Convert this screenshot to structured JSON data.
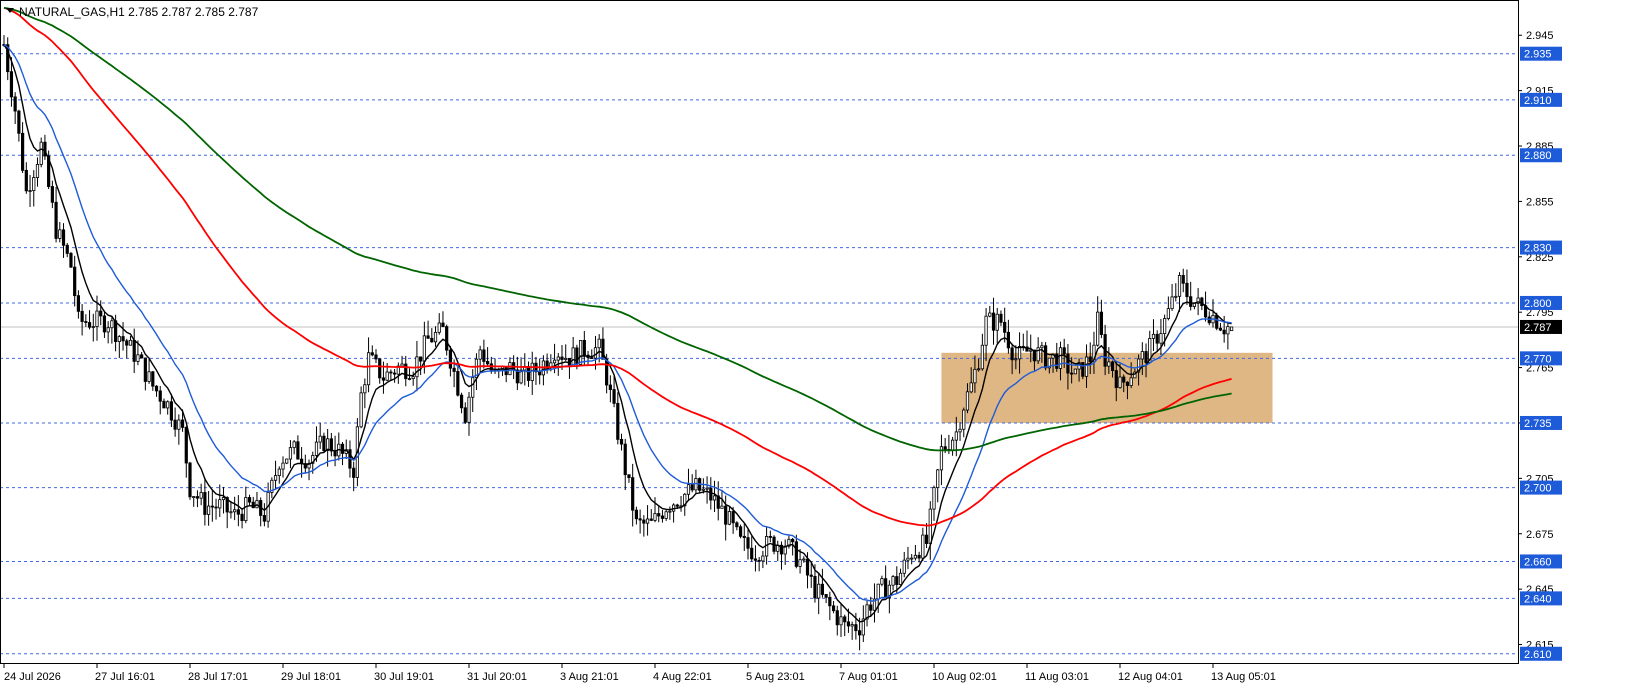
{
  "header": {
    "symbol_line": "NATURAL_GAS,H1  2.785 2.787 2.785 2.787",
    "menu_icon": "triangle-down-icon"
  },
  "chart_data": {
    "type": "candlestick",
    "symbol": "NATURAL_GAS",
    "timeframe": "H1",
    "ohlc_last": {
      "open": 2.785,
      "high": 2.787,
      "low": 2.785,
      "close": 2.787
    },
    "current_price": 2.787,
    "ylim": [
      2.605,
      2.963
    ],
    "y_ticks": [
      2.945,
      2.915,
      2.885,
      2.855,
      2.825,
      2.795,
      2.765,
      2.735,
      2.705,
      2.675,
      2.645,
      2.615
    ],
    "price_levels": [
      2.935,
      2.91,
      2.88,
      2.83,
      2.8,
      2.77,
      2.735,
      2.7,
      2.66,
      2.64,
      2.61
    ],
    "x_labels": [
      "24 Jul 2026",
      "27 Jul 16:01",
      "28 Jul 17:01",
      "29 Jul 18:01",
      "30 Jul 19:01",
      "31 Jul 20:01",
      "3 Aug 21:01",
      "4 Aug 22:01",
      "5 Aug 23:01",
      "7 Aug 01:01",
      "10 Aug 02:01",
      "11 Aug 03:01",
      "12 Aug 04:01",
      "13 Aug 05:01"
    ],
    "x_label_bars": [
      0,
      25,
      50,
      75,
      100,
      125,
      150,
      175,
      200,
      225,
      250,
      275,
      300,
      325
    ],
    "bar_count": 331,
    "close_anchors": [
      [
        0,
        2.94
      ],
      [
        3,
        2.905
      ],
      [
        6,
        2.86
      ],
      [
        10,
        2.885
      ],
      [
        14,
        2.84
      ],
      [
        18,
        2.82
      ],
      [
        20,
        2.79
      ],
      [
        24,
        2.79
      ],
      [
        28,
        2.79
      ],
      [
        32,
        2.78
      ],
      [
        36,
        2.77
      ],
      [
        40,
        2.755
      ],
      [
        44,
        2.745
      ],
      [
        48,
        2.73
      ],
      [
        50,
        2.7
      ],
      [
        54,
        2.69
      ],
      [
        58,
        2.69
      ],
      [
        62,
        2.685
      ],
      [
        66,
        2.69
      ],
      [
        70,
        2.685
      ],
      [
        72,
        2.7
      ],
      [
        74,
        2.715
      ],
      [
        78,
        2.72
      ],
      [
        82,
        2.715
      ],
      [
        86,
        2.725
      ],
      [
        90,
        2.72
      ],
      [
        94,
        2.71
      ],
      [
        96,
        2.75
      ],
      [
        98,
        2.77
      ],
      [
        102,
        2.76
      ],
      [
        106,
        2.765
      ],
      [
        110,
        2.765
      ],
      [
        114,
        2.78
      ],
      [
        118,
        2.785
      ],
      [
        120,
        2.77
      ],
      [
        122,
        2.755
      ],
      [
        124,
        2.74
      ],
      [
        126,
        2.76
      ],
      [
        128,
        2.775
      ],
      [
        132,
        2.76
      ],
      [
        136,
        2.765
      ],
      [
        140,
        2.76
      ],
      [
        144,
        2.765
      ],
      [
        148,
        2.775
      ],
      [
        152,
        2.77
      ],
      [
        156,
        2.775
      ],
      [
        160,
        2.775
      ],
      [
        162,
        2.76
      ],
      [
        166,
        2.72
      ],
      [
        170,
        2.68
      ],
      [
        174,
        2.68
      ],
      [
        178,
        2.69
      ],
      [
        182,
        2.695
      ],
      [
        186,
        2.7
      ],
      [
        190,
        2.695
      ],
      [
        194,
        2.685
      ],
      [
        198,
        2.67
      ],
      [
        202,
        2.665
      ],
      [
        206,
        2.67
      ],
      [
        210,
        2.67
      ],
      [
        214,
        2.66
      ],
      [
        218,
        2.645
      ],
      [
        222,
        2.635
      ],
      [
        226,
        2.625
      ],
      [
        230,
        2.625
      ],
      [
        232,
        2.635
      ],
      [
        236,
        2.645
      ],
      [
        240,
        2.65
      ],
      [
        244,
        2.665
      ],
      [
        248,
        2.67
      ],
      [
        250,
        2.695
      ],
      [
        252,
        2.72
      ],
      [
        256,
        2.73
      ],
      [
        258,
        2.745
      ],
      [
        260,
        2.755
      ],
      [
        262,
        2.77
      ],
      [
        264,
        2.79
      ],
      [
        268,
        2.79
      ],
      [
        272,
        2.77
      ],
      [
        276,
        2.775
      ],
      [
        280,
        2.77
      ],
      [
        284,
        2.77
      ],
      [
        288,
        2.76
      ],
      [
        292,
        2.77
      ],
      [
        294,
        2.79
      ],
      [
        296,
        2.77
      ],
      [
        298,
        2.765
      ],
      [
        300,
        2.755
      ],
      [
        304,
        2.765
      ],
      [
        308,
        2.775
      ],
      [
        312,
        2.79
      ],
      [
        316,
        2.81
      ],
      [
        320,
        2.8
      ],
      [
        324,
        2.795
      ],
      [
        328,
        2.787
      ],
      [
        330,
        2.787
      ]
    ],
    "series": [
      {
        "name": "",
        "color": "#000000",
        "kind": "ema",
        "period": 8
      },
      {
        "name": "",
        "color": "#1e5bd8",
        "kind": "ema",
        "period": 21
      },
      {
        "name": "",
        "color": "#ff0000",
        "kind": "ema",
        "period": 100
      },
      {
        "name": "",
        "color": "#006400",
        "kind": "ema",
        "period": 200
      }
    ],
    "zone": {
      "bar_start": 252,
      "bar_end": 341,
      "high": 2.773,
      "low": 2.735,
      "color": "#d9aa6e"
    },
    "grid": false
  },
  "colors": {
    "background": "#ffffff",
    "candle": "#000000",
    "level_line": "#4169e1",
    "level_box": "#1e5bd8",
    "level_text": "#ffffff",
    "current_box": "#000000",
    "current_line": "#c0c0c0",
    "axis": "#000000",
    "text": "#000000"
  }
}
